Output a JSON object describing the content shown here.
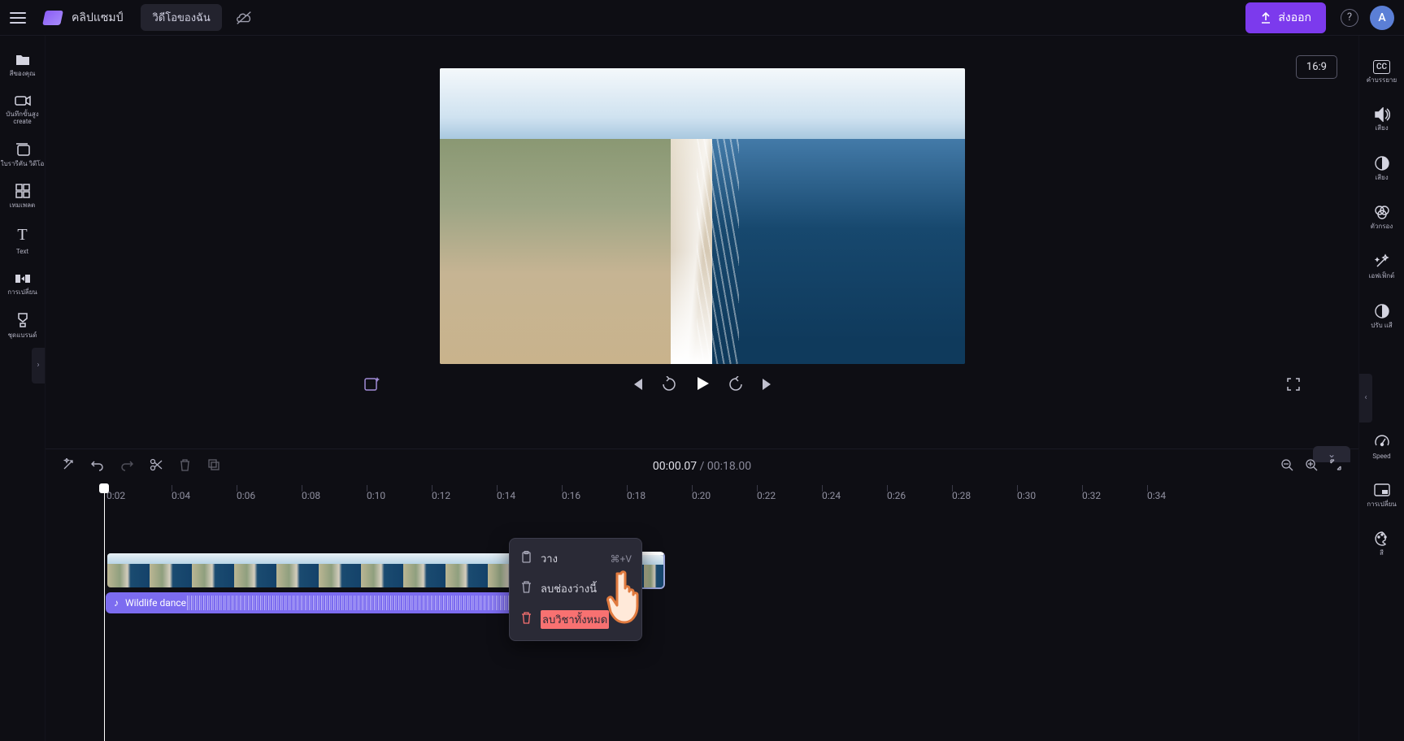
{
  "header": {
    "project_title": "คลิปแซมป์",
    "tab_label": "วิดีโอของฉัน",
    "export_label": "ส่งออก",
    "avatar_letter": "A",
    "help_char": "?"
  },
  "aspect_ratio": "16:9",
  "left_sidebar": [
    {
      "label": "สีของคุณ"
    },
    {
      "label": "บันทึกขั้นสูง\ncreate"
    },
    {
      "label": "ใบรารีคัน\nวิดีโอ"
    },
    {
      "label": "เทมเพลต"
    },
    {
      "label": "Text"
    },
    {
      "label": "การเปลี่ยน"
    },
    {
      "label": "ชุดแบรนด์"
    }
  ],
  "right_sidebar": [
    {
      "label": "คำบรรยาย"
    },
    {
      "label": "เสียง"
    },
    {
      "label": "เสียง"
    },
    {
      "label": "ตัวกรอง"
    },
    {
      "label": "เอฟเฟ็กต์"
    },
    {
      "label": "ปรับ\nแสี"
    },
    {
      "label": "Speed"
    },
    {
      "label": "การเปลี่ยน"
    },
    {
      "label": "สี"
    }
  ],
  "timeline": {
    "current": "00:00.07",
    "separator": " / ",
    "duration": "00:18.00",
    "ticks": [
      "0:02",
      "0:04",
      "0:06",
      "0:08",
      "0:10",
      "0:12",
      "0:14",
      "0:16",
      "0:18",
      "0:20",
      "0:22",
      "0:24",
      "0:26",
      "0:28",
      "0:30",
      "0:32",
      "0:34"
    ]
  },
  "audio_clip_label": "Wildlife dance",
  "context_menu": {
    "paste": {
      "label": "วาง",
      "shortcut": "⌘+V"
    },
    "delete_empty": {
      "label": "ลบช่องว่างนี้"
    },
    "delete_all": {
      "label": "ลบวิชาทั้งหมด"
    }
  }
}
